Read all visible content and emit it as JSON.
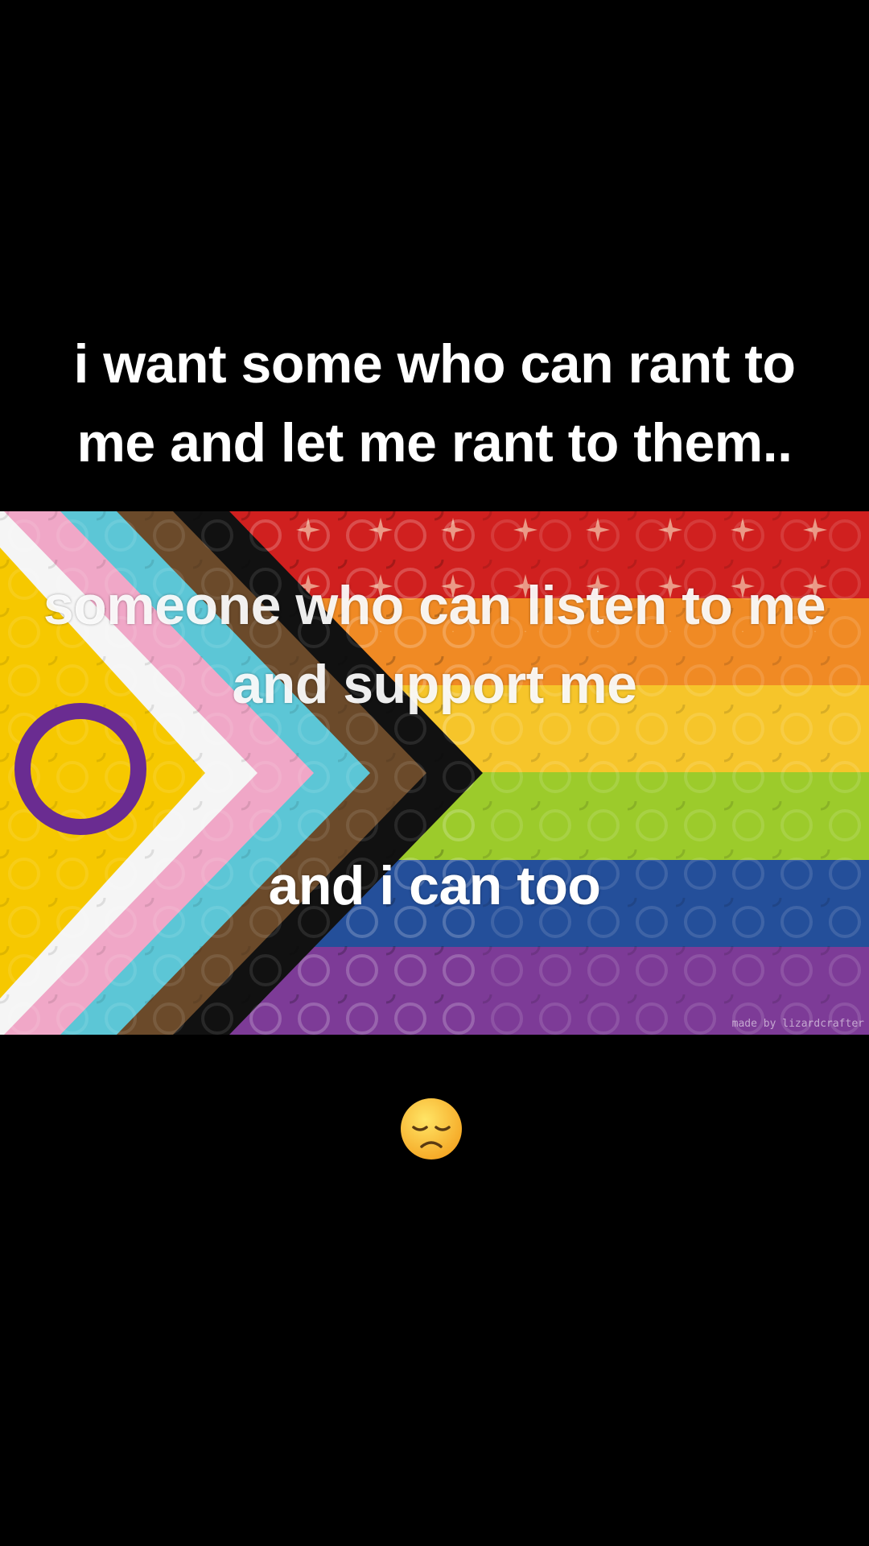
{
  "captions": {
    "top": "i want some who can rant to me and let me rant to them..",
    "middle": "someone who can listen to me and support me",
    "lower": "and i can too"
  },
  "watermark": "made by lizardcrafter",
  "emoji": {
    "icon": "disappointed-face-icon"
  },
  "colors": {
    "background": "#000000",
    "text": "#ffffff",
    "flag_red": "#d0201f",
    "flag_orange": "#f08a24",
    "flag_yellow": "#f6c52a",
    "flag_green": "#9ccb2b",
    "flag_blue": "#244f9a",
    "flag_purple": "#7d3b97",
    "flag_black": "#111111",
    "flag_brown": "#6b4a2a",
    "flag_light_blue": "#5cc6d6",
    "flag_pink": "#f0a7c7",
    "flag_white": "#f5f5f5",
    "intersex_yellow": "#f6c800",
    "intersex_purple": "#6a2c91"
  }
}
